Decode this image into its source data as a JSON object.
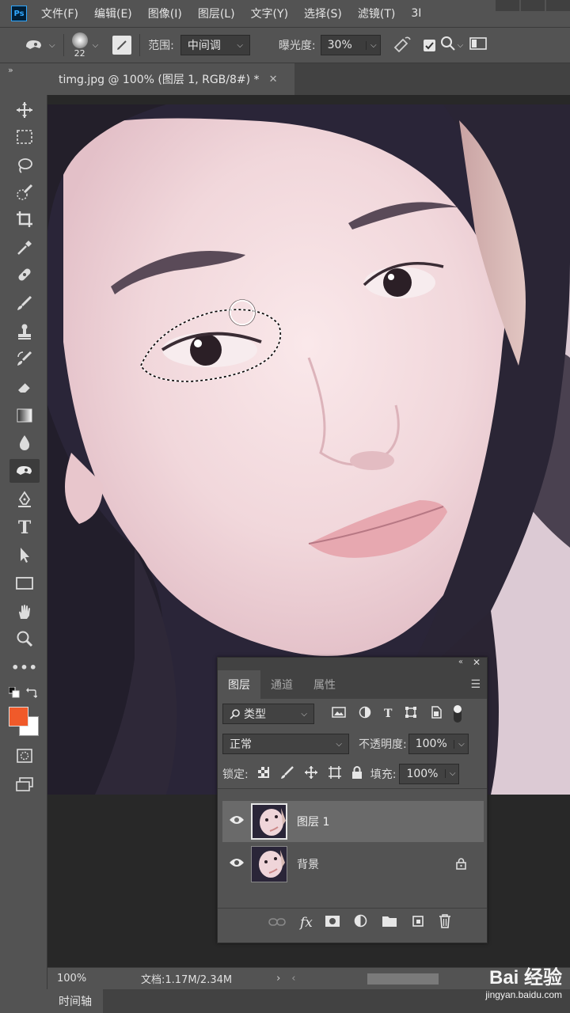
{
  "app": {
    "logo": "Ps"
  },
  "menu": [
    "文件(F)",
    "编辑(E)",
    "图像(I)",
    "图层(L)",
    "文字(Y)",
    "选择(S)",
    "滤镜(T)",
    "3I"
  ],
  "options": {
    "brush_size": "22",
    "range_label": "范围:",
    "range_value": "中间调",
    "exposure_label": "曝光度:",
    "exposure_value": "30%"
  },
  "document": {
    "tab_title": "timg.jpg @ 100% (图层 1, RGB/8#) *",
    "close": "✕"
  },
  "status": {
    "zoom": "100%",
    "doc_info": "文档:1.17M/2.34M"
  },
  "timeline": {
    "label": "时间轴"
  },
  "layers_panel": {
    "tabs": [
      "图层",
      "通道",
      "属性"
    ],
    "filter_label": "类型",
    "blend_mode": "正常",
    "opacity_label": "不透明度:",
    "opacity_value": "100%",
    "lock_label": "锁定:",
    "fill_label": "填充:",
    "fill_value": "100%",
    "layers": [
      {
        "name": "图层 1",
        "selected": true,
        "locked": false
      },
      {
        "name": "背景",
        "selected": false,
        "locked": true
      }
    ]
  },
  "watermark": {
    "brand": "Bai 经验",
    "url": "jingyan.baidu.com"
  },
  "colors": {
    "foreground": "#f05a2a",
    "background": "#ffffff",
    "accent": "#31a8ff"
  }
}
